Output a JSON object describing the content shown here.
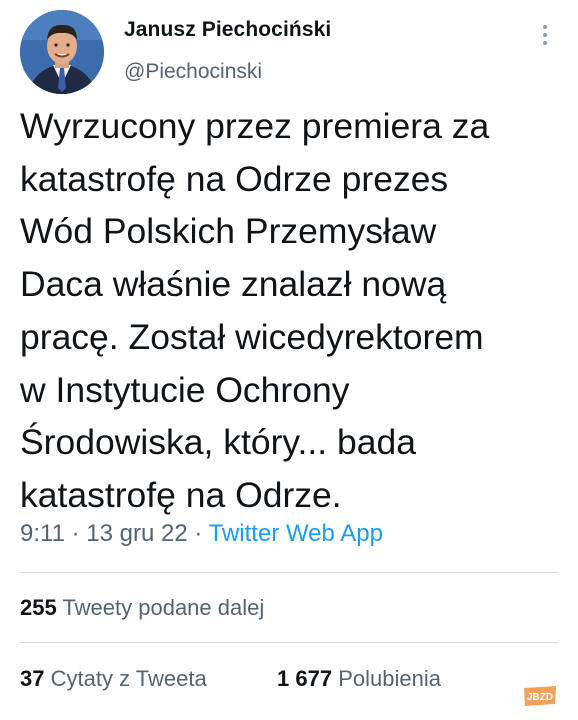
{
  "author": {
    "name": "Janusz Piechociński",
    "handle": "@Piechocinski"
  },
  "tweet": {
    "lines": [
      "Wyrzucony przez premiera za",
      "katastrofę na Odrze prezes",
      "Wód Polskich Przemysław",
      "Daca właśnie znalazł nową",
      "pracę. Został wicedyrektorem",
      "w Instytucie Ochrony",
      "Środowiska, który... bada",
      "katastrofę na Odrze."
    ]
  },
  "meta": {
    "time": "9:11",
    "separator": "·",
    "date": "13 gru 22",
    "source": "Twitter Web App"
  },
  "stats": {
    "retweets_count": "255",
    "retweets_label": "Tweety podane dalej",
    "quotes_count": "37",
    "quotes_label": "Cytaty z Tweeta",
    "likes_count": "1 677",
    "likes_label": "Polubienia"
  },
  "watermark": {
    "text": "JBZD"
  },
  "colors": {
    "text": "#0f1419",
    "secondary": "#536471",
    "link": "#1d9bf0",
    "divider": "#d3d9de",
    "watermark": "#f2a25a"
  },
  "icons": {
    "more": "more-vertical-icon",
    "avatar": "profile-photo"
  }
}
